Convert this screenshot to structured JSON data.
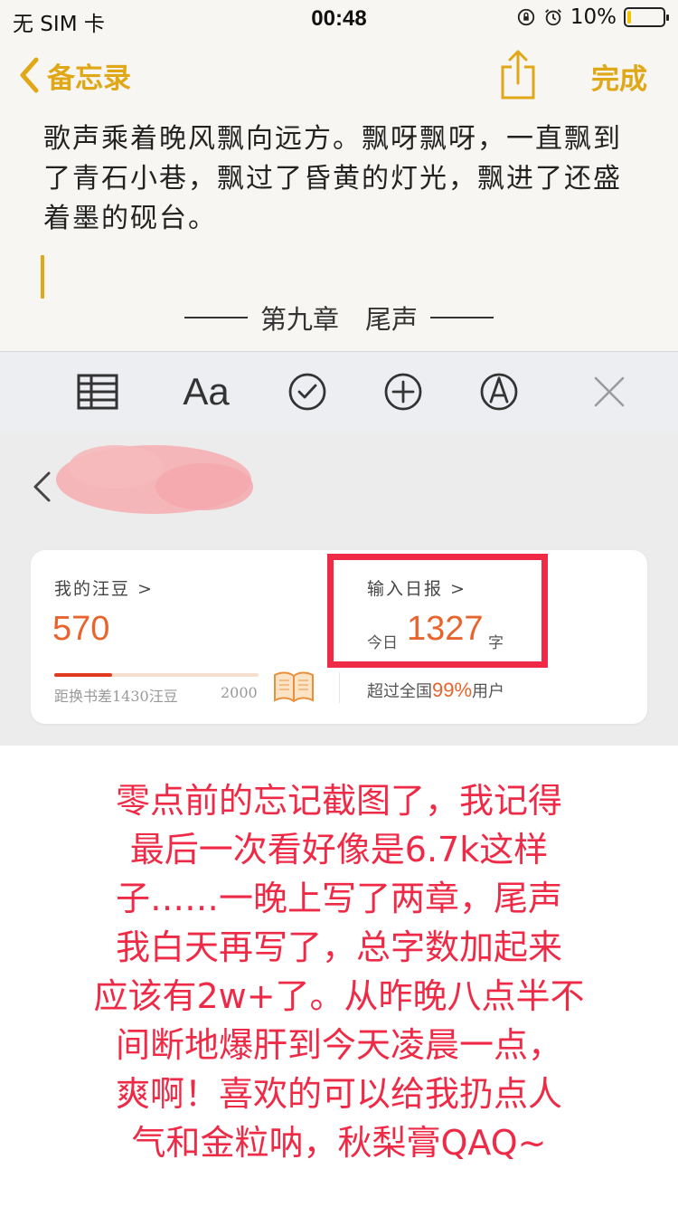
{
  "status_bar": {
    "carrier": "无 SIM 卡",
    "time": "00:48",
    "battery": "10%",
    "battery_level": 0.1
  },
  "nav": {
    "back_label": "备忘录",
    "done_label": "完成",
    "accent_color": "#e0a716"
  },
  "note": {
    "body": "歌声乘着晚风飘向远方。飘呀飘呀，一直飘到了青石小巷，飘过了昏黄的灯光，飘进了还盛着墨的砚台。",
    "chapter_title": "第九章　尾声"
  },
  "toolbar": {
    "items": [
      "table-icon",
      "text-format-icon",
      "checklist-icon",
      "add-icon",
      "markup-pen-icon",
      "close-icon"
    ],
    "format_label": "Aa"
  },
  "app_card": {
    "beans_title": "我的汪豆 >",
    "beans_value": "570",
    "beans_progress": 0.285,
    "beans_diff": "距换书差1430汪豆",
    "beans_max": "2000",
    "report_title": "输入日报 >",
    "today_label": "今日",
    "today_value": "1327",
    "today_unit": "字",
    "exceed_prefix": "超过全国",
    "exceed_pct": "99%",
    "exceed_suffix": "用户",
    "accent_color": "#e8642c",
    "highlight_color": "#ee2a46"
  },
  "caption": {
    "lines": [
      "零点前的忘记截图了，我记得",
      "最后一次看好像是6.7k这样",
      "子……一晚上写了两章，尾声",
      "我白天再写了，总字数加起来",
      "应该有2w+了。从昨晚八点半不",
      "间断地爆肝到今天凌晨一点，",
      "爽啊！喜欢的可以给我扔点人",
      "气和金粒呐，秋梨膏QAQ~"
    ]
  }
}
